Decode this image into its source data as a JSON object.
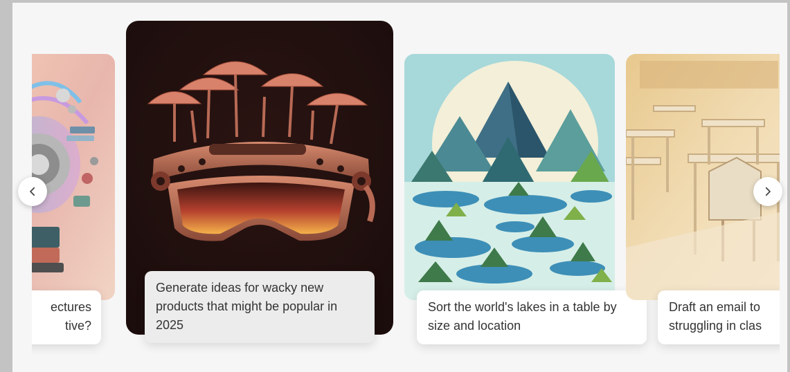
{
  "carousel": {
    "cards": [
      {
        "caption": "Explain the architectures that are effective?",
        "visible_caption_line1": "ectures",
        "visible_caption_line2": "tive?"
      },
      {
        "caption": "Generate ideas for wacky new products that might be popular in 2025"
      },
      {
        "caption": "Sort the world's lakes in a table by size and location"
      },
      {
        "caption": "Draft an email to",
        "caption_line2": "struggling in clas"
      }
    ],
    "prev_icon": "chevron-left-icon",
    "next_icon": "chevron-right-icon"
  },
  "colors": {
    "panel_bg": "#f6f6f6",
    "frame_bg": "#c3c3c3",
    "caption_bg": "#ffffff",
    "text": "#333333"
  }
}
